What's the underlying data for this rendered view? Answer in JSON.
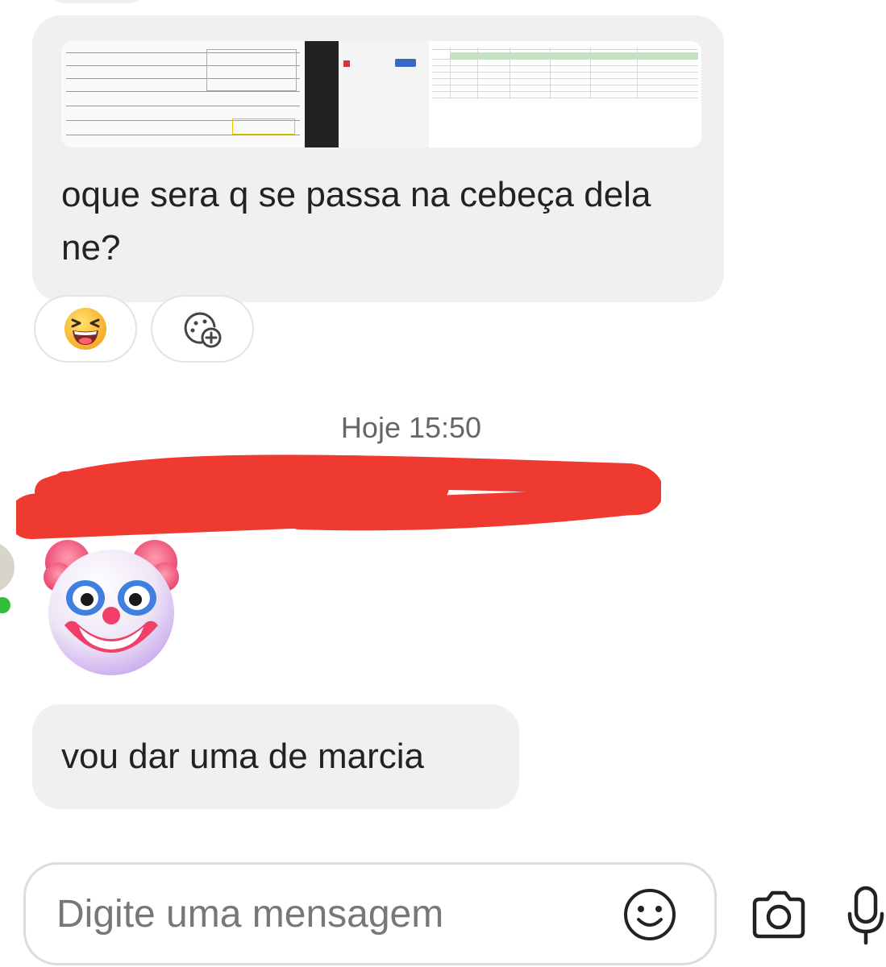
{
  "messages": [
    {
      "text": "oque sera q se passa na cebeça dela ne?",
      "has_image_attachment": true,
      "reactions": [
        {
          "icon": "laughing-squinting-face-icon"
        },
        {
          "icon": "add-reaction-icon"
        }
      ]
    },
    {
      "sticker": "clown-face-icon"
    },
    {
      "text": "vou dar uma de marcia"
    }
  ],
  "timestamp": "Hoje 15:50",
  "sender_name_redacted": true,
  "composer": {
    "placeholder": "Digite uma mensagem",
    "emoji_icon": "smiley-icon",
    "camera_icon": "camera-icon",
    "mic_icon": "microphone-icon"
  },
  "colors": {
    "bubble": "#f1f0f0",
    "redaction": "#ef3a31",
    "online": "#2fbf3a"
  }
}
